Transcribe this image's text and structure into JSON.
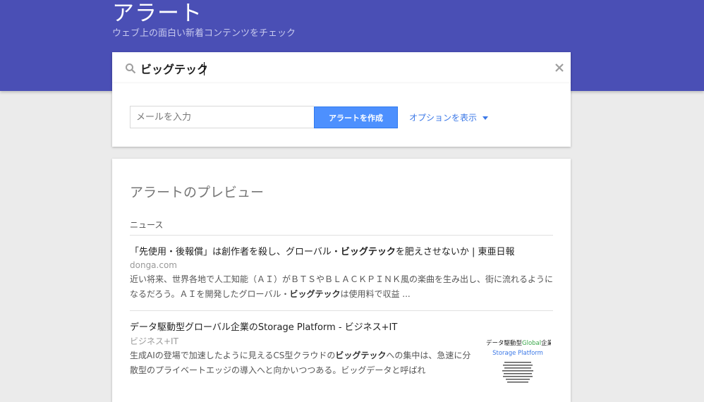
{
  "header": {
    "title": "アラート",
    "subtitle": "ウェブ上の面白い新着コンテンツをチェック"
  },
  "search": {
    "value": "ビッグテック",
    "icon": "search-icon",
    "clear_icon": "close-icon"
  },
  "create_form": {
    "email_placeholder": "メールを入力",
    "create_button": "アラートを作成",
    "options_link": "オプションを表示"
  },
  "preview": {
    "title": "アラートのプレビュー",
    "section": "ニュース",
    "items": [
      {
        "title_before": "「先使用・後報償」は創作者を殺し、グローバル・",
        "title_bold": "ビッグテック",
        "title_after": "を肥えさせないか | 東亜日報",
        "source": "donga.com",
        "snippet_line1": "近い将来、世界各地で人工知能（ＡＩ）がＢＴＳやＢＬＡＣＫＰＩＮＫ風の楽曲を生み出し、街に流れるように",
        "snippet_line2_before": "なるだろう。ＡＩを開発したグローバル・",
        "snippet_line2_bold": "ビッグテック",
        "snippet_line2_after": "は使用料で収益 ..."
      },
      {
        "title": "データ駆動型グローバル企業のStorage Platform - ビジネス+IT",
        "source": "ビジネス+IT",
        "snippet_line1_before": "生成AIの登場で加速したように見えるCS型クラウドの",
        "snippet_line1_bold": "ビッグテック",
        "snippet_line1_after": "への集中は、急速に分",
        "snippet_line2": "散型のプライベートエッジの導入へと向かいつつある。ビッグデータと呼ばれ",
        "thumbnail": {
          "line1_a": "データ駆動型",
          "line1_b": "Global",
          "line1_c": "企業における",
          "line2": "Storage Platform"
        }
      }
    ]
  }
}
